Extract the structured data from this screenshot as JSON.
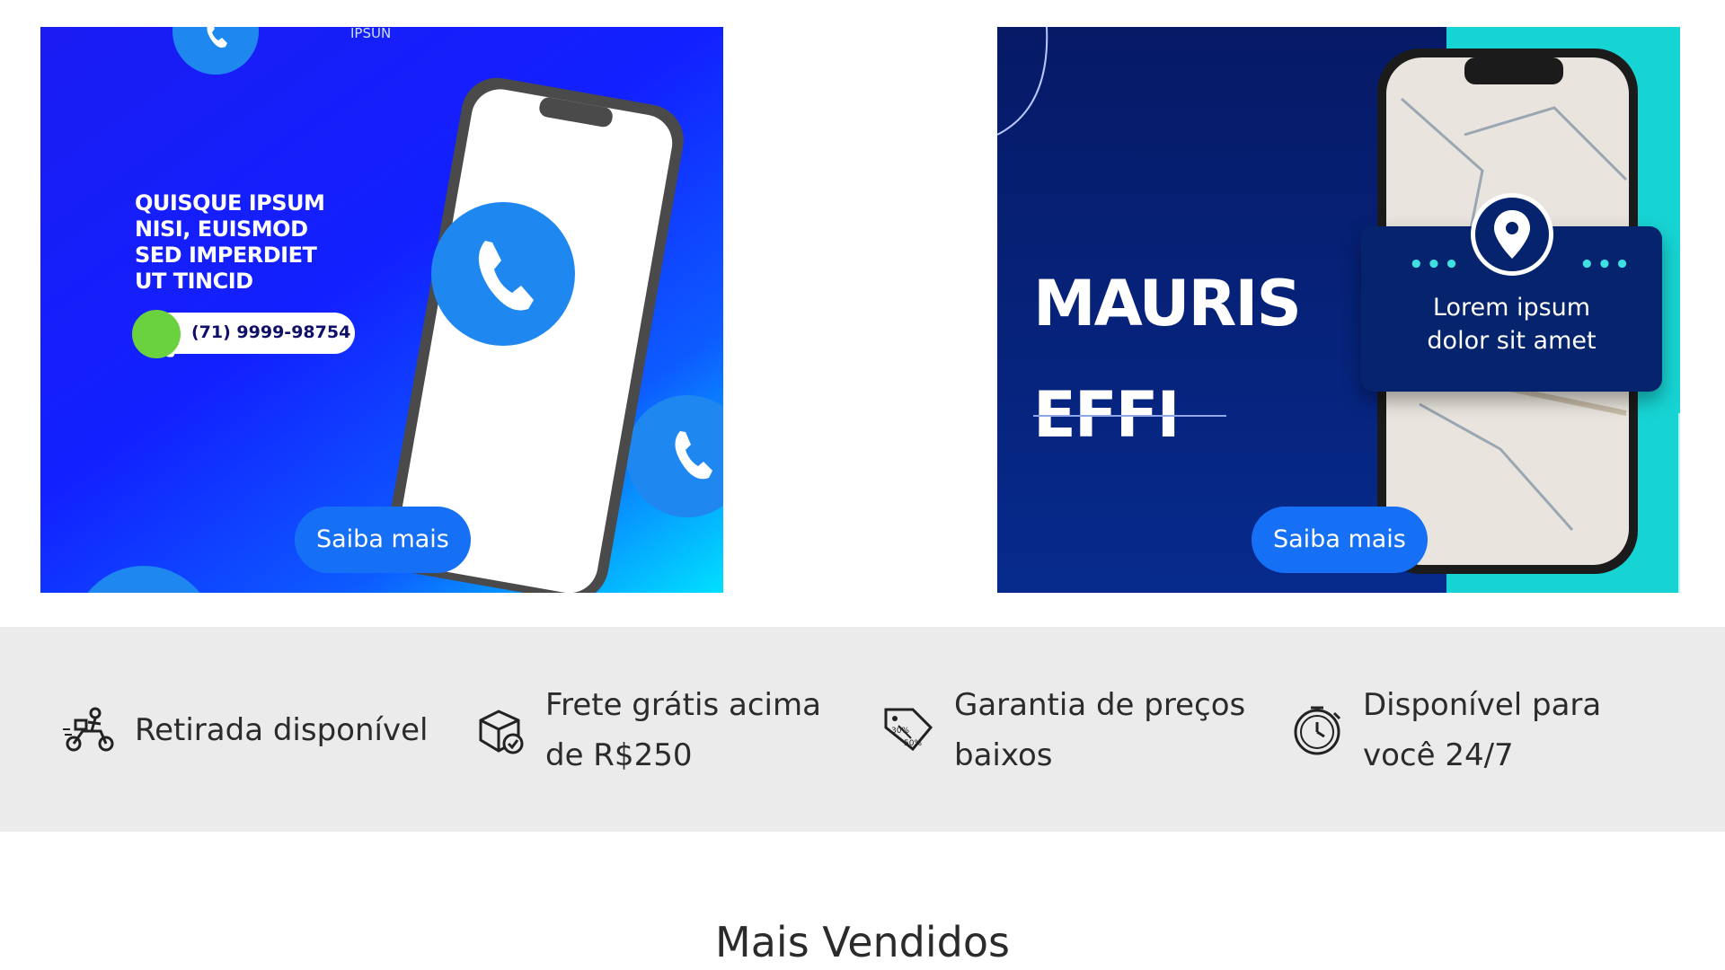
{
  "banners": [
    {
      "brand": "IPSUN",
      "headline": "QUISQUE IPSUM\nNISI, EUISMOD\nSED IMPERDIET\nUT TINCID",
      "phone": "(71) 9999-98754",
      "button": "Saiba mais"
    },
    {
      "title": "MAURIS\nEFFI",
      "card_text": "Lorem ipsum\ndolor sit amet",
      "button": "Saiba mais"
    }
  ],
  "features": [
    {
      "icon": "scooter-delivery-icon",
      "text": "Retirada disponível"
    },
    {
      "icon": "box-check-icon",
      "text": "Frete grátis acima\nde R$250"
    },
    {
      "icon": "price-tag-icon",
      "text": "Garantia de preços\nbaixos"
    },
    {
      "icon": "clock-icon",
      "text": "Disponível para\nvocê 24/7"
    }
  ],
  "section_title": "Mais Vendidos",
  "colors": {
    "primary_button": "#1670f5",
    "feature_bg": "#ebebeb",
    "navy": "#061a66",
    "teal": "#17d4d4"
  }
}
